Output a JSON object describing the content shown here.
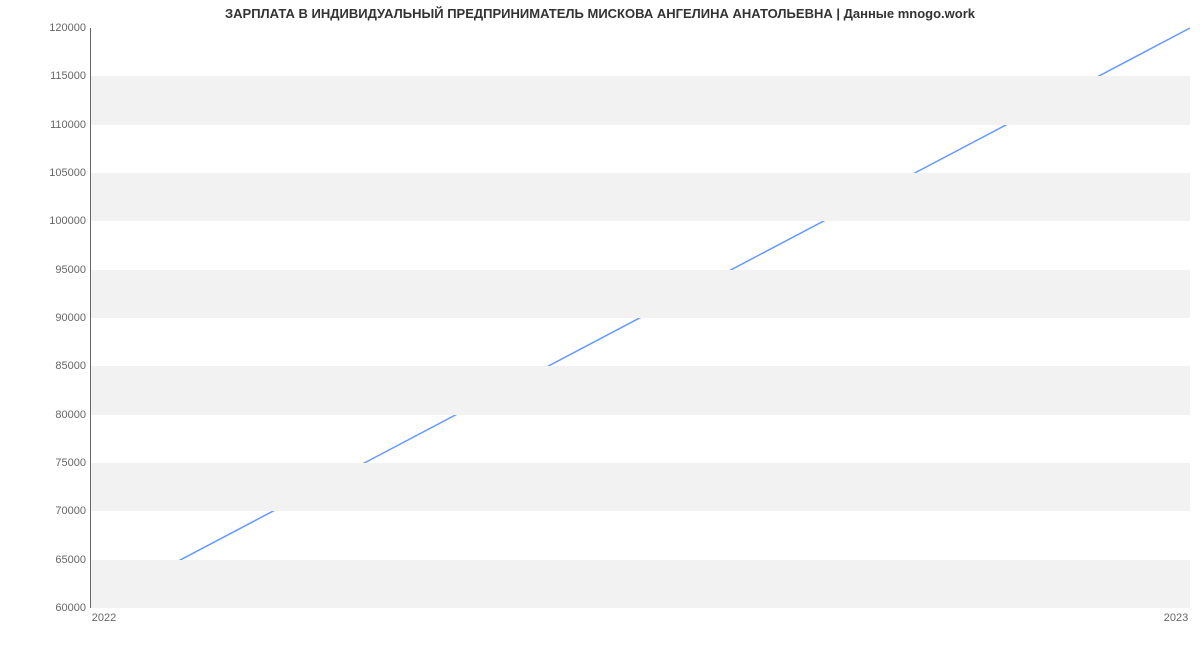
{
  "chart_data": {
    "type": "line",
    "title": "ЗАРПЛАТА В ИНДИВИДУАЛЬНЫЙ ПРЕДПРИНИМАТЕЛЬ МИСКОВА АНГЕЛИНА АНАТОЛЬЕВНА | Данные mnogo.work",
    "xlabel": "",
    "ylabel": "",
    "x": [
      "2022",
      "2023"
    ],
    "series": [
      {
        "name": "Зарплата",
        "values": [
          60000,
          120000
        ],
        "color": "#6699ff"
      }
    ],
    "ylim": [
      60000,
      120000
    ],
    "y_ticks": [
      60000,
      65000,
      70000,
      75000,
      80000,
      85000,
      90000,
      95000,
      100000,
      105000,
      110000,
      115000,
      120000
    ],
    "grid": true,
    "legend": false
  }
}
